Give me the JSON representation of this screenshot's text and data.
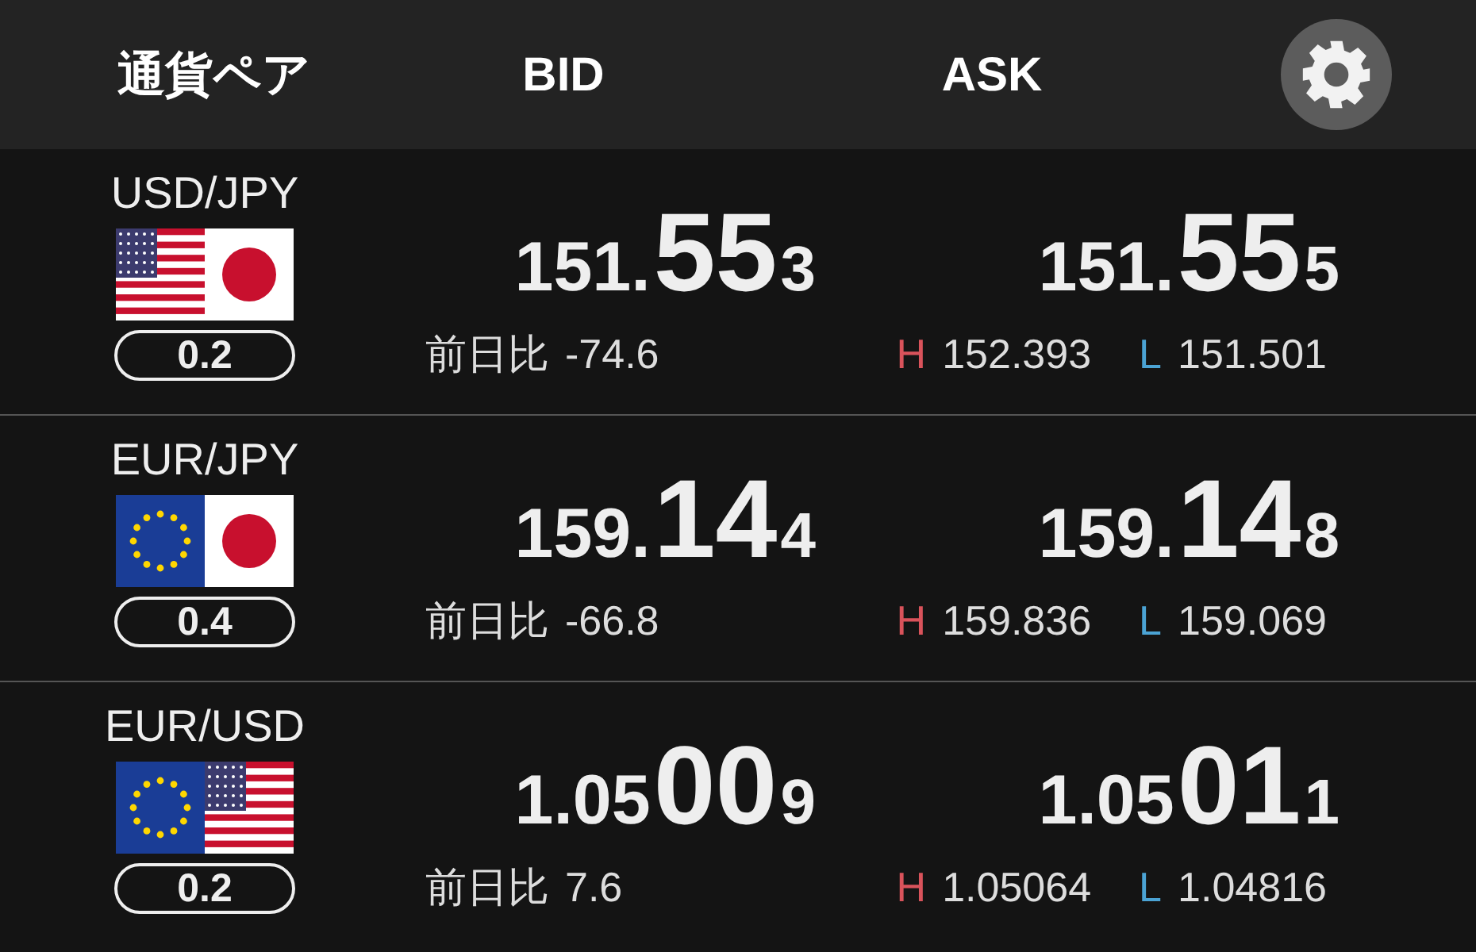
{
  "header": {
    "pair_label": "通貨ペア",
    "bid_label": "BID",
    "ask_label": "ASK"
  },
  "rows": [
    {
      "pair": "USD/JPY",
      "flags": [
        {
          "kind": "us"
        },
        {
          "kind": "jp"
        }
      ],
      "spread": "0.2",
      "bid": {
        "head": "151.",
        "big": "55",
        "tail": "3"
      },
      "ask": {
        "head": "151.",
        "big": "55",
        "tail": "5"
      },
      "change_label": "前日比",
      "change": "-74.6",
      "high_label": "H",
      "high": "152.393",
      "low_label": "L",
      "low": "151.501"
    },
    {
      "pair": "EUR/JPY",
      "flags": [
        {
          "kind": "eu"
        },
        {
          "kind": "jp"
        }
      ],
      "spread": "0.4",
      "bid": {
        "head": "159.",
        "big": "14",
        "tail": "4"
      },
      "ask": {
        "head": "159.",
        "big": "14",
        "tail": "8"
      },
      "change_label": "前日比",
      "change": "-66.8",
      "high_label": "H",
      "high": "159.836",
      "low_label": "L",
      "low": "159.069"
    },
    {
      "pair": "EUR/USD",
      "flags": [
        {
          "kind": "eu"
        },
        {
          "kind": "us"
        }
      ],
      "spread": "0.2",
      "bid": {
        "head": "1.05",
        "big": "00",
        "tail": "9"
      },
      "ask": {
        "head": "1.05",
        "big": "01",
        "tail": "1"
      },
      "change_label": "前日比",
      "change": "7.6",
      "high_label": "H",
      "high": "1.05064",
      "low_label": "L",
      "low": "1.04816"
    }
  ]
}
